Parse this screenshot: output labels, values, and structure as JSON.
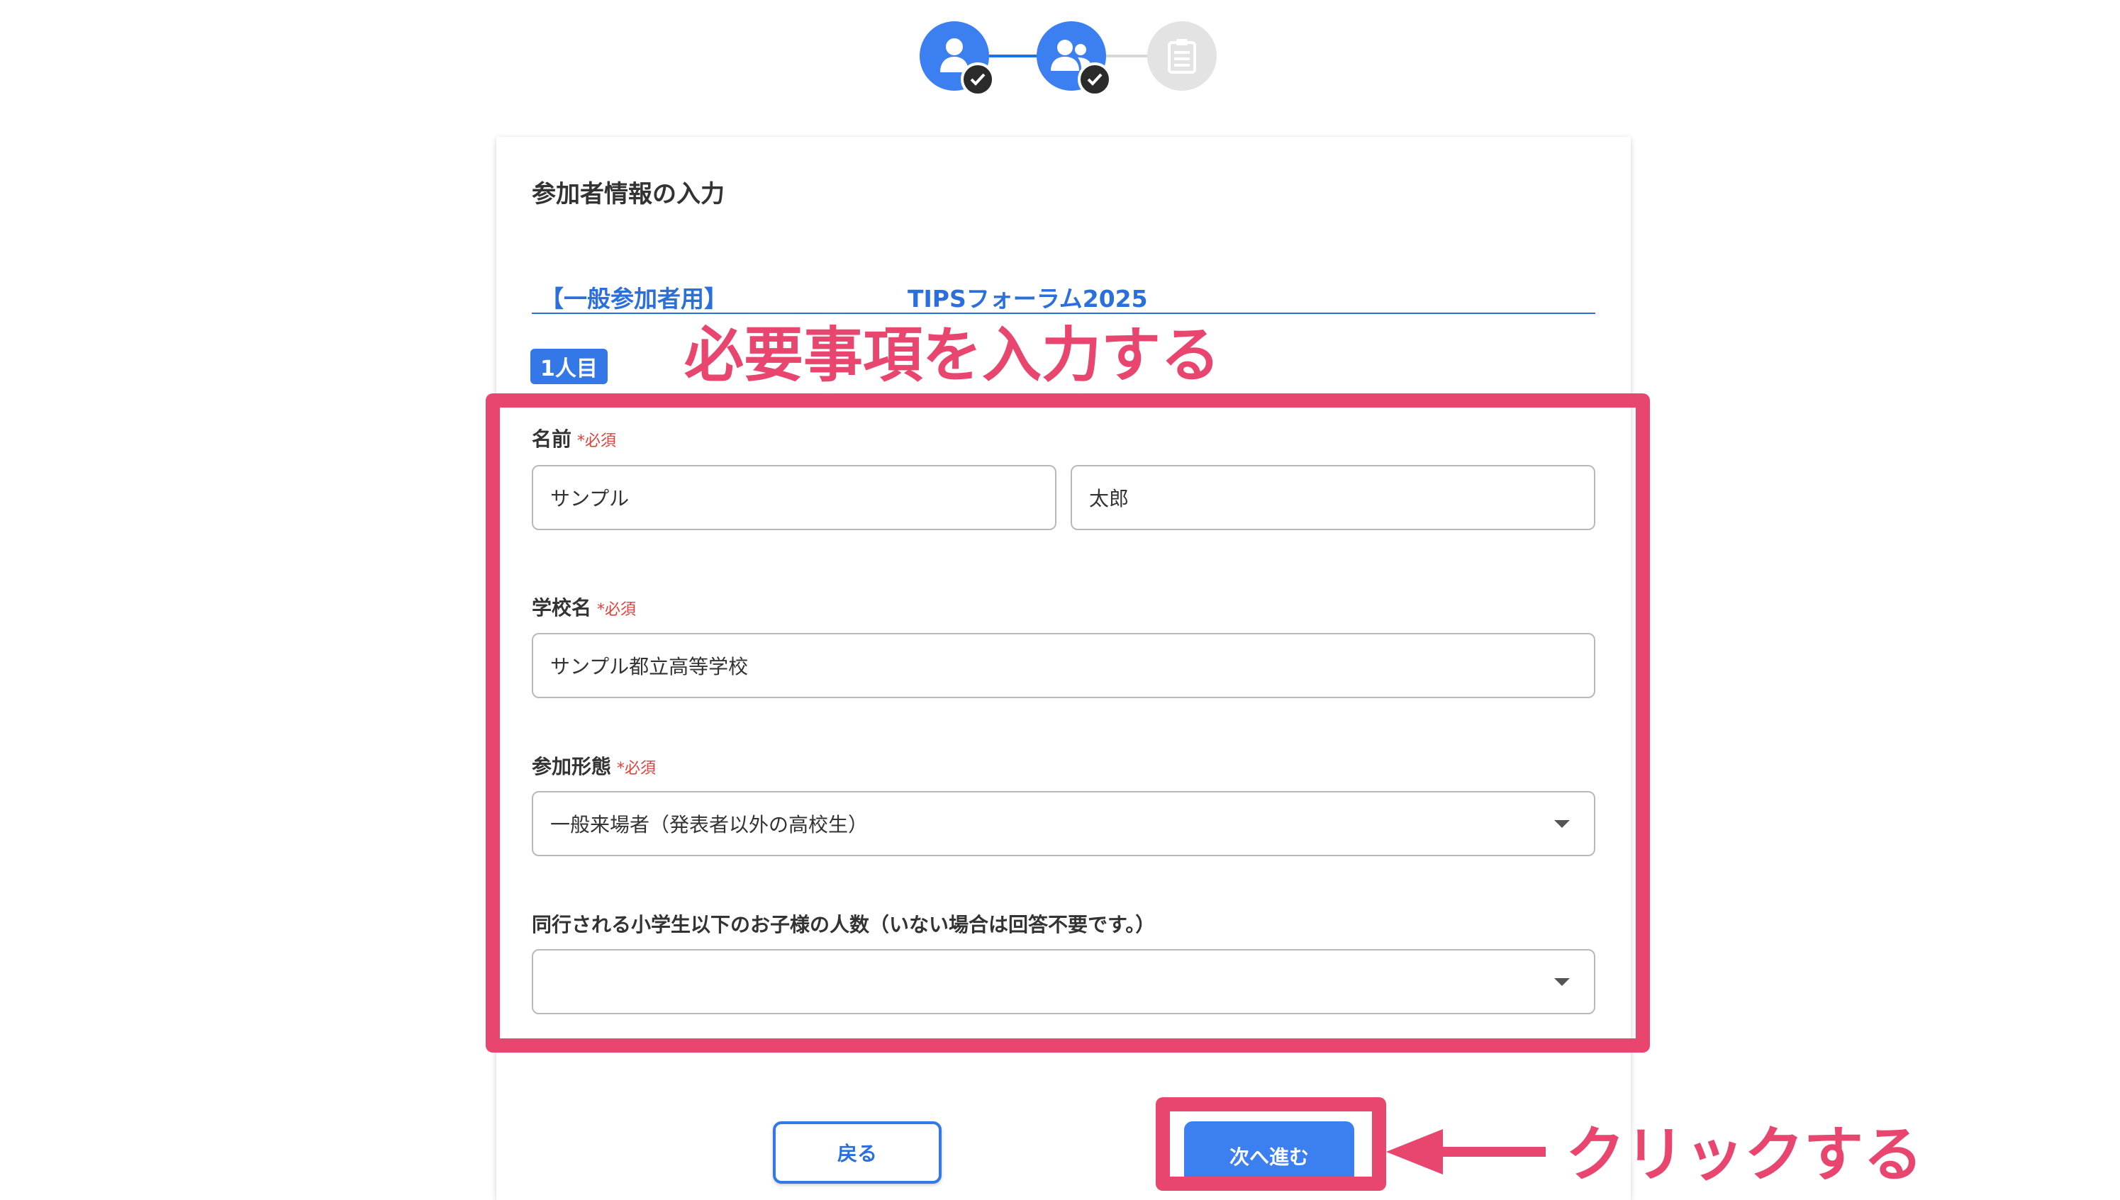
{
  "stepper": {
    "steps": [
      {
        "icon": "person-icon",
        "state": "completed"
      },
      {
        "icon": "people-icon",
        "state": "completed"
      },
      {
        "icon": "clipboard-icon",
        "state": "pending"
      }
    ]
  },
  "form": {
    "title": "参加者情報の入力",
    "tabs": [
      {
        "label": "【一般参加者用】"
      },
      {
        "label": "TIPSフォーラム2025"
      }
    ],
    "person_badge": "1人目",
    "required_mark": "*必須",
    "name": {
      "label": "名前",
      "last_value": "サンプル",
      "first_value": "太郎"
    },
    "school": {
      "label": "学校名",
      "value": "サンプル都立高等学校"
    },
    "participation": {
      "label": "参加形態",
      "value": "一般来場者（発表者以外の高校生）"
    },
    "children": {
      "label": "同行される小学生以下のお子様の人数（いない場合は回答不要です。）",
      "value": ""
    }
  },
  "buttons": {
    "back": "戻る",
    "next": "次へ進む"
  },
  "annotations": {
    "fill_in": "必要事項を入力する",
    "click": "クリックする",
    "color": "#e8466e"
  },
  "colors": {
    "accent": "#3b7ff0",
    "required": "#e0413a"
  }
}
